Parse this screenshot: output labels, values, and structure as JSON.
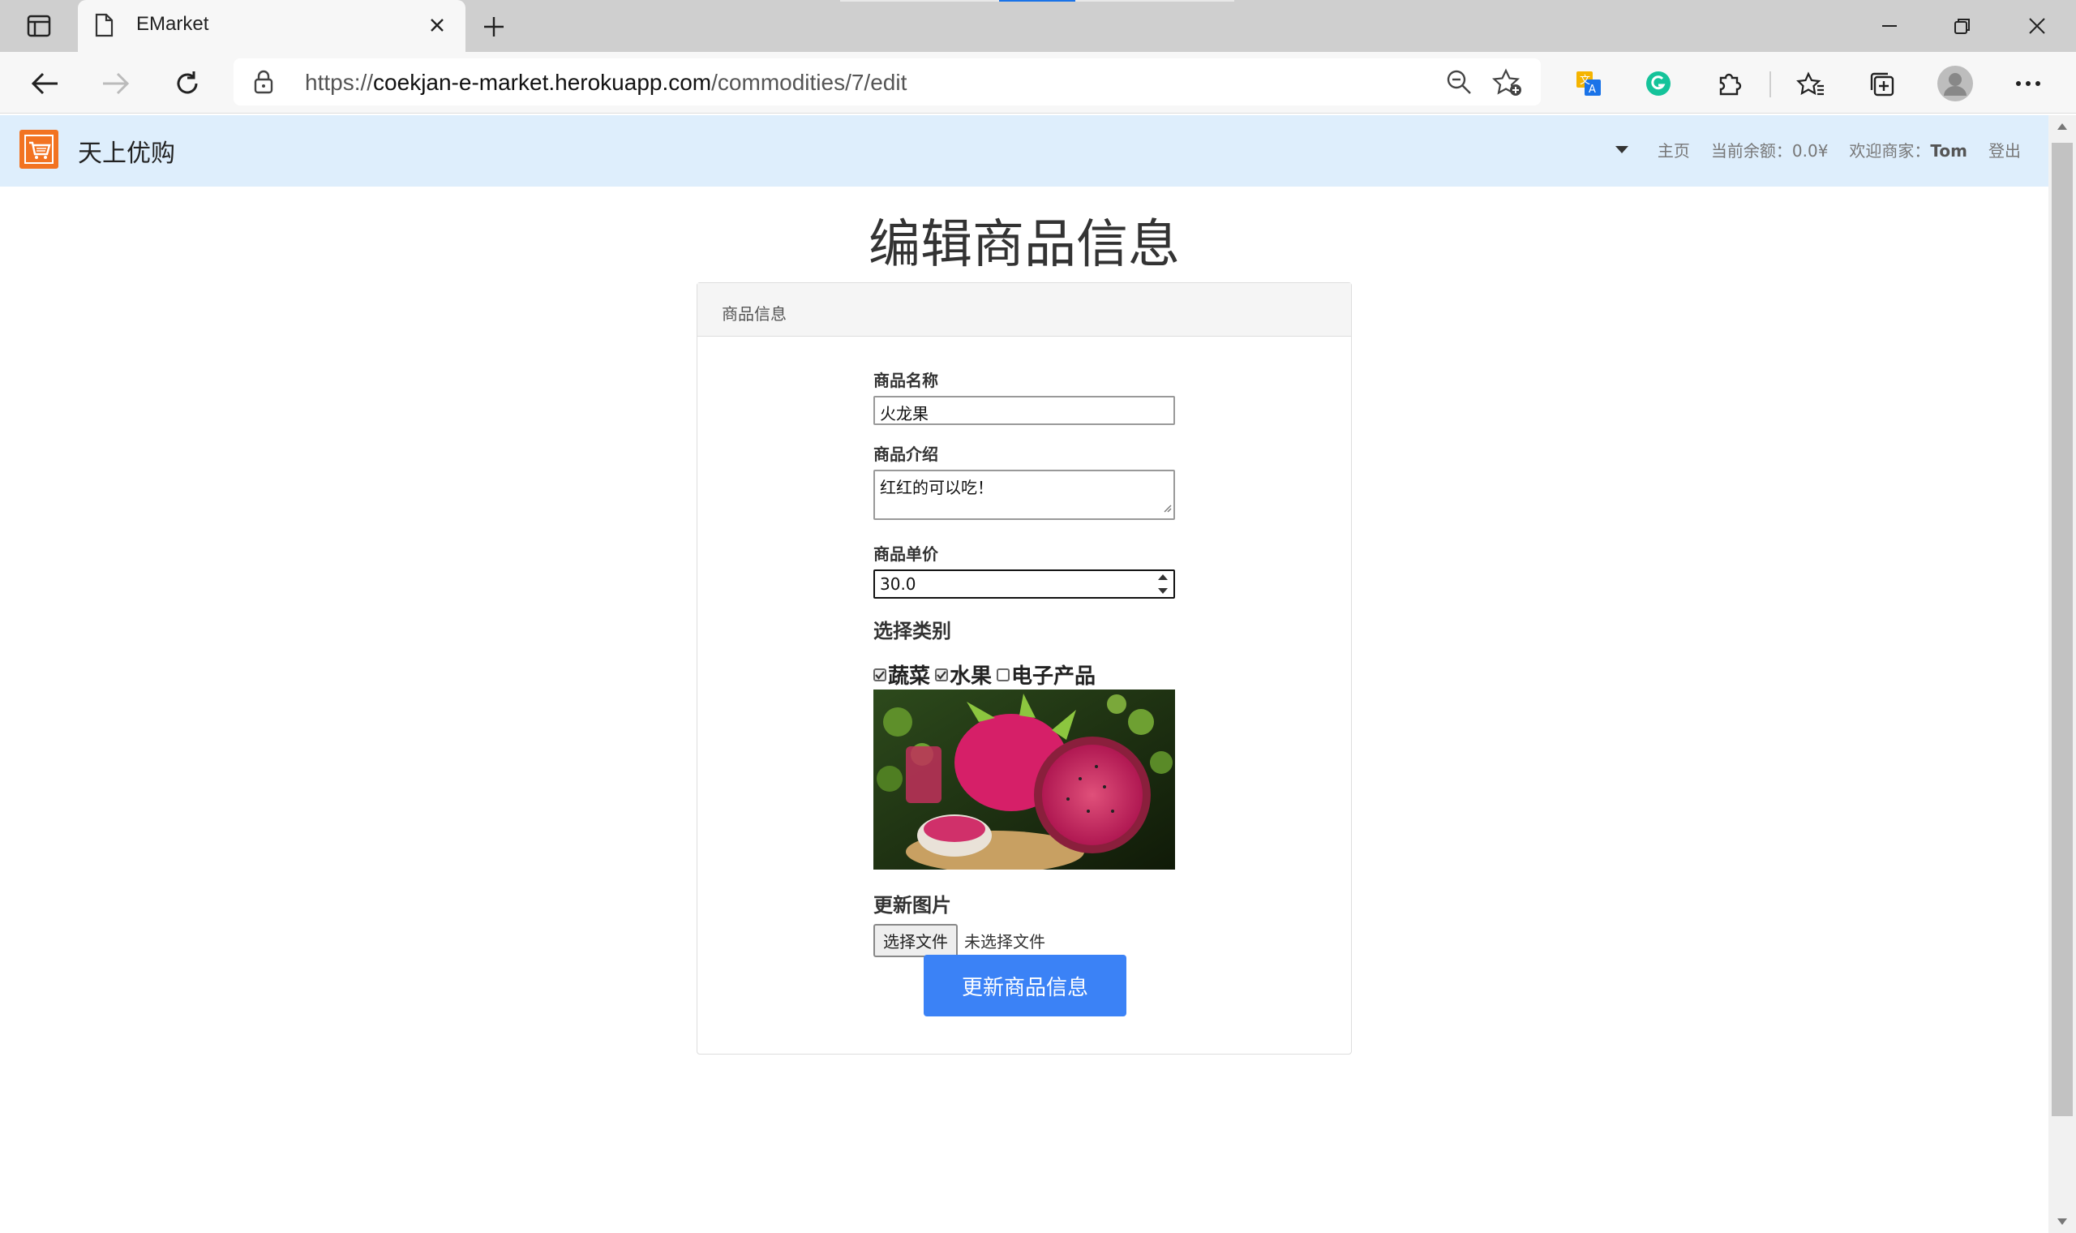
{
  "browser": {
    "tab_title": "EMarket",
    "url_prefix": "https://",
    "url_host": "coekjan-e-market.herokuapp.com",
    "url_path": "/commodities/7/edit"
  },
  "navbar": {
    "brand": "天上优购",
    "home": "主页",
    "balance": "当前余额：0.0¥",
    "welcome": "欢迎商家：",
    "user": "Tom",
    "logout": "登出"
  },
  "page": {
    "title": "编辑商品信息",
    "panel_heading": "商品信息"
  },
  "form": {
    "name_label": "商品名称",
    "name_value": "火龙果",
    "desc_label": "商品介绍",
    "desc_value": "红红的可以吃！",
    "price_label": "商品单价",
    "price_value": "30.0",
    "category_label": "选择类别",
    "categories": [
      {
        "label": "蔬菜",
        "checked": true
      },
      {
        "label": "水果",
        "checked": true
      },
      {
        "label": "电子产品",
        "checked": false
      }
    ],
    "image_label": "更新图片",
    "file_button": "选择文件",
    "file_status": "未选择文件",
    "submit": "更新商品信息"
  },
  "colors": {
    "navbar_bg": "#deeefc",
    "submit_bg": "#3b82f6",
    "logo_bg": "#f27321"
  }
}
